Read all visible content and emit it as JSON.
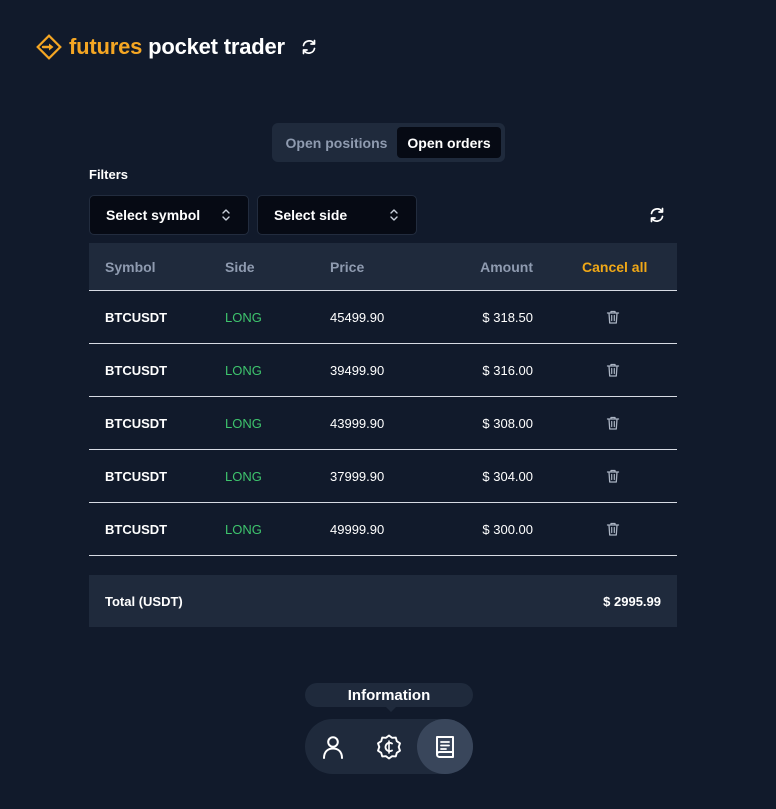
{
  "app": {
    "title_accent": "futures",
    "title_rest": "pocket trader",
    "logo_icon": "diamond-arrow-icon",
    "accent_color": "#f5a623"
  },
  "tabs": [
    {
      "label": "Open positions",
      "active": false
    },
    {
      "label": "Open orders",
      "active": true
    }
  ],
  "filters": {
    "label": "Filters",
    "symbol_select": "Select symbol",
    "side_select": "Select side"
  },
  "table": {
    "headers": {
      "symbol": "Symbol",
      "side": "Side",
      "price": "Price",
      "amount": "Amount",
      "action": "Cancel all"
    },
    "rows": [
      {
        "symbol": "BTCUSDT",
        "side": "LONG",
        "price": "45499.90",
        "amount": "$ 318.50"
      },
      {
        "symbol": "BTCUSDT",
        "side": "LONG",
        "price": "39499.90",
        "amount": "$ 316.00"
      },
      {
        "symbol": "BTCUSDT",
        "side": "LONG",
        "price": "43999.90",
        "amount": "$ 308.00"
      },
      {
        "symbol": "BTCUSDT",
        "side": "LONG",
        "price": "37999.90",
        "amount": "$ 304.00"
      },
      {
        "symbol": "BTCUSDT",
        "side": "LONG",
        "price": "49999.90",
        "amount": "$ 300.00"
      }
    ],
    "footer": {
      "label": "Total (USDT)",
      "value": "$ 2995.99"
    },
    "long_color": "#3ec46d",
    "cancel_color": "#f0a817"
  },
  "bottom_nav": {
    "tooltip": "Information",
    "items": [
      {
        "icon": "user-icon"
      },
      {
        "icon": "coin-badge-icon"
      },
      {
        "icon": "book-icon",
        "active": true
      }
    ]
  }
}
